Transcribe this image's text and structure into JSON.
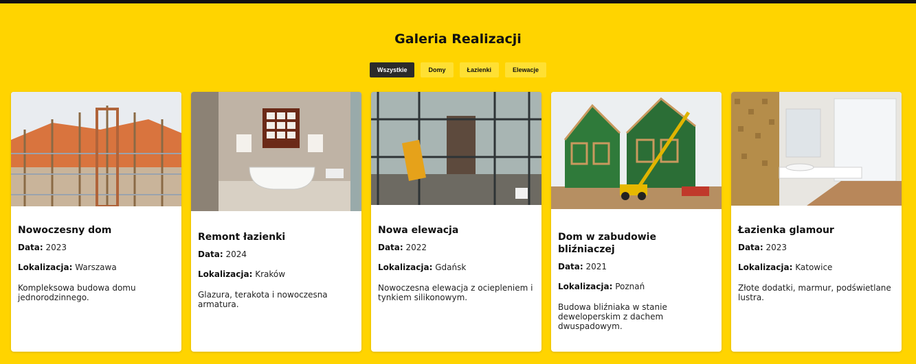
{
  "header": {
    "title": "Galeria Realizacji"
  },
  "filters": [
    "Wszystkie",
    "Domy",
    "Łazienki",
    "Elewacje"
  ],
  "labels": {
    "date": "Data:",
    "location": "Lokalizacja:"
  },
  "cards": [
    {
      "title": "Nowoczesny dom",
      "date": "2023",
      "location": "Warszawa",
      "description": "Kompleksowa budowa domu jednorodzinnego.",
      "image_icon": "house-framing-photo"
    },
    {
      "title": "Remont łazienki",
      "date": "2024",
      "location": "Kraków",
      "description": "Glazura, terakota i nowoczesna armatura.",
      "image_icon": "bathroom-photo"
    },
    {
      "title": "Nowa elewacja",
      "date": "2022",
      "location": "Gdańsk",
      "description": "Nowoczesna elewacja z ociepleniem i tynkiem silikonowym.",
      "image_icon": "facade-scaffolding-photo"
    },
    {
      "title": "Dom w zabudowie bliźniaczej",
      "date": "2021",
      "location": "Poznań",
      "description": "Budowa bliźniaka w stanie deweloperskim z dachem dwuspadowym.",
      "image_icon": "semi-detached-house-photo"
    },
    {
      "title": "Łazienka glamour",
      "date": "2023",
      "location": "Katowice",
      "description": "Złote dodatki, marmur, podświetlane lustra.",
      "image_icon": "glamour-bathroom-photo"
    }
  ]
}
